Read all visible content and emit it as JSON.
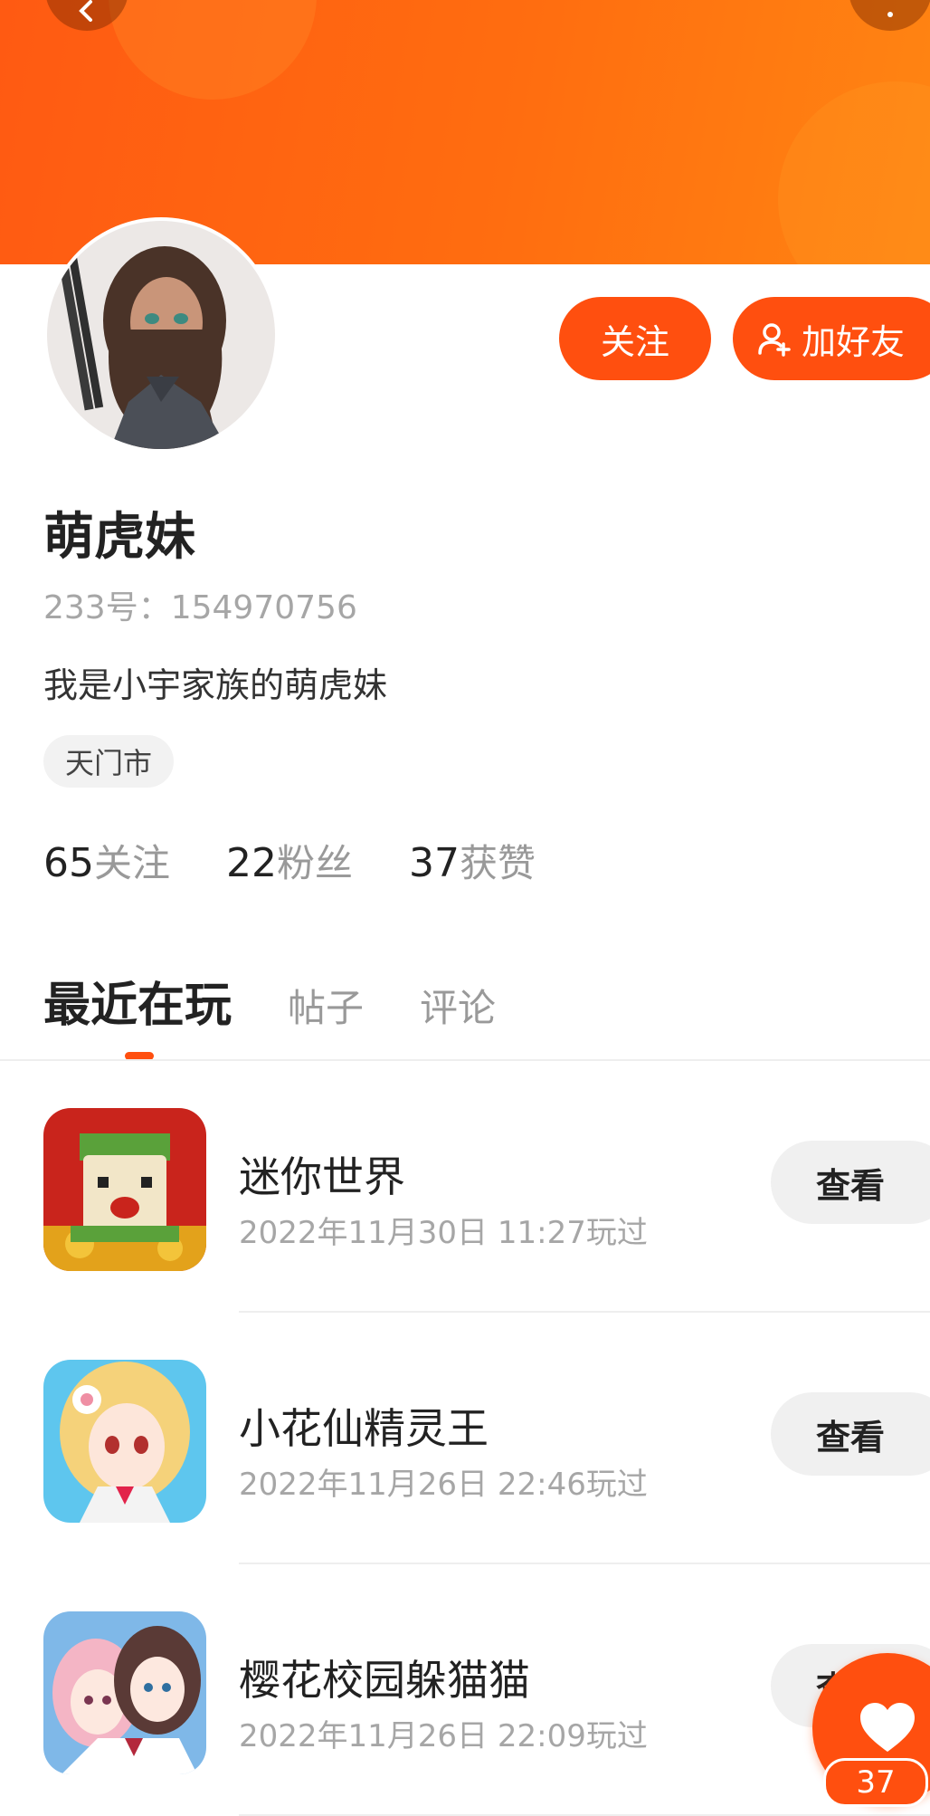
{
  "profile": {
    "name": "萌虎妹",
    "uid_label": "233号：",
    "uid_value": "154970756",
    "bio": "我是小宇家族的萌虎妹",
    "location": "天门市"
  },
  "actions": {
    "follow_label": "关注",
    "add_friend_label": "加好友"
  },
  "stats": [
    {
      "count": "65",
      "label": "关注"
    },
    {
      "count": "22",
      "label": "粉丝"
    },
    {
      "count": "37",
      "label": "获赞"
    }
  ],
  "tabs": [
    {
      "label": "最近在玩",
      "active": true
    },
    {
      "label": "帖子",
      "active": false
    },
    {
      "label": "评论",
      "active": false
    }
  ],
  "games": [
    {
      "title": "迷你世界",
      "played": "2022年11月30日 11:27玩过",
      "button": "查看"
    },
    {
      "title": "小花仙精灵王",
      "played": "2022年11月26日 22:46玩过",
      "button": "查看"
    },
    {
      "title": "樱花校园躲猫猫",
      "played": "2022年11月26日 22:09玩过",
      "button": "查看"
    }
  ],
  "like": {
    "count": "37"
  },
  "colors": {
    "accent": "#ff4f0f",
    "banner_start": "#ff5a12",
    "banner_end": "#ff8512"
  }
}
